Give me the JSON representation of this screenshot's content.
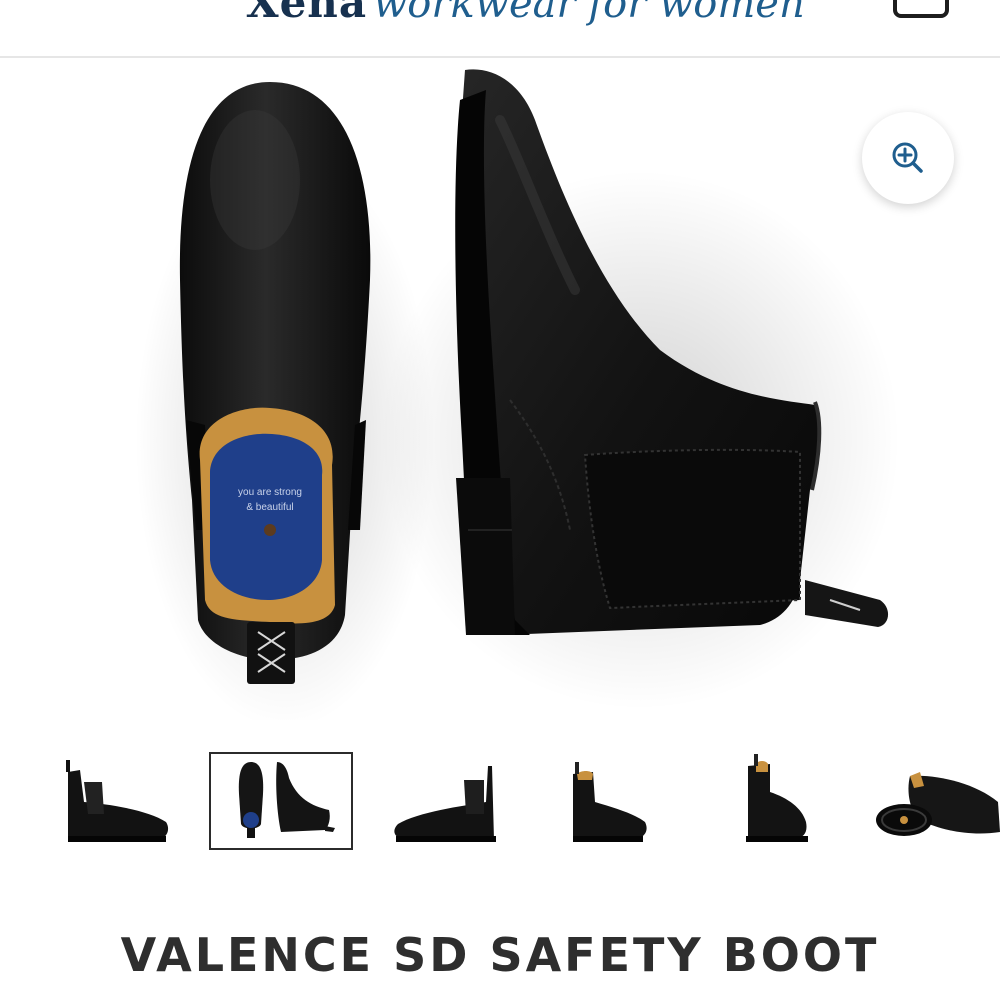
{
  "header": {
    "brand": "Xena",
    "tagline": "workwear for women",
    "menu_icon": "hamburger-menu-icon",
    "cart_icon": "shopping-bag-icon"
  },
  "gallery": {
    "insole_text_line1": "you are strong",
    "insole_text_line2": "& beautiful",
    "zoom_icon": "zoom-in-icon",
    "thumbnail_count": 6,
    "active_thumbnail": 2
  },
  "product": {
    "title": "VALENCE SD SAFETY BOOT"
  },
  "colors": {
    "brand_navy": "#17314f",
    "brand_blue": "#1f5e8e",
    "boot_black": "#111111",
    "insole_blue": "#1f3f8a",
    "lining_tan": "#c8913f"
  }
}
